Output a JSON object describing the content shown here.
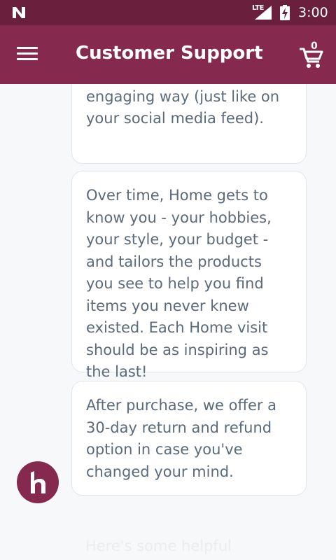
{
  "status_bar": {
    "network": "LTE",
    "time": "3:00"
  },
  "app_bar": {
    "title": "Customer Support",
    "cart_count": "0"
  },
  "messages": [
    {
      "text": "present them to you in an engaging way (just like on your social media feed)."
    },
    {
      "text": "Over time, Home gets to know you - your hobbies, your style, your budget - and tailors the products you see to help you find items you never knew existed. Each Home visit should be as inspiring as the last!"
    },
    {
      "text": "After purchase, we offer a 30-day return and refund option in case you've changed your mind."
    }
  ],
  "faded_message": "Here's some helpful",
  "colors": {
    "status_bar": "#6a1f3c",
    "app_bar": "#852a4e",
    "bubble_text": "#5a6a7a",
    "background": "#f7f8fa"
  },
  "icons": {
    "menu": "hamburger-menu-icon",
    "cart": "shopping-cart-icon",
    "home": "home-logo-icon"
  }
}
